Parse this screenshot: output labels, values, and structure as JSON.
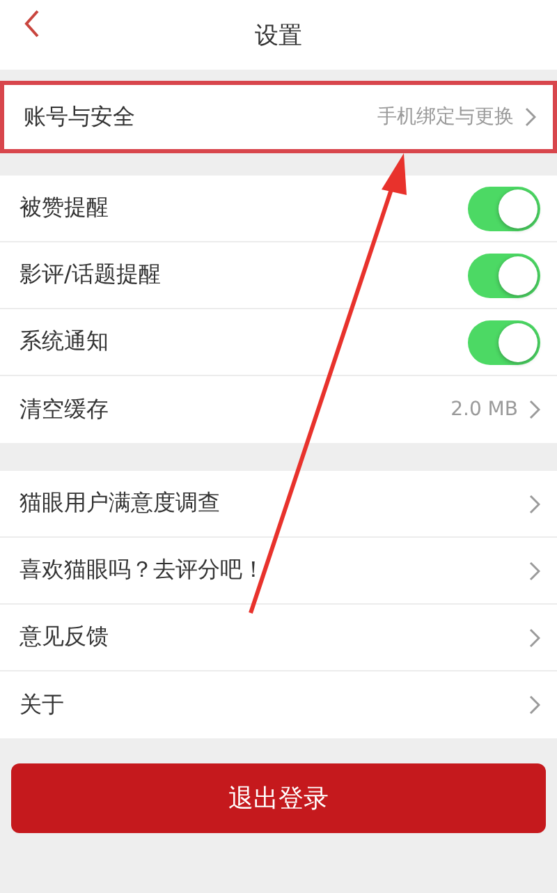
{
  "nav": {
    "title": "设置"
  },
  "groups": [
    {
      "rows": [
        {
          "kind": "link",
          "label": "账号与安全",
          "detail": "手机绑定与更换",
          "highlighted": true
        }
      ]
    },
    {
      "rows": [
        {
          "kind": "toggle",
          "label": "被赞提醒",
          "on": true
        },
        {
          "kind": "toggle",
          "label": "影评/话题提醒",
          "on": true
        },
        {
          "kind": "toggle",
          "label": "系统通知",
          "on": true
        },
        {
          "kind": "link",
          "label": "清空缓存",
          "detail": "2.0 MB"
        }
      ]
    },
    {
      "rows": [
        {
          "kind": "link",
          "label": "猫眼用户满意度调查"
        },
        {
          "kind": "link",
          "label": "喜欢猫眼吗？去评分吧！"
        },
        {
          "kind": "link",
          "label": "意见反馈"
        },
        {
          "kind": "link",
          "label": "关于"
        }
      ]
    }
  ],
  "logout_button": "退出登录",
  "annotation": {
    "kind": "arrow"
  }
}
